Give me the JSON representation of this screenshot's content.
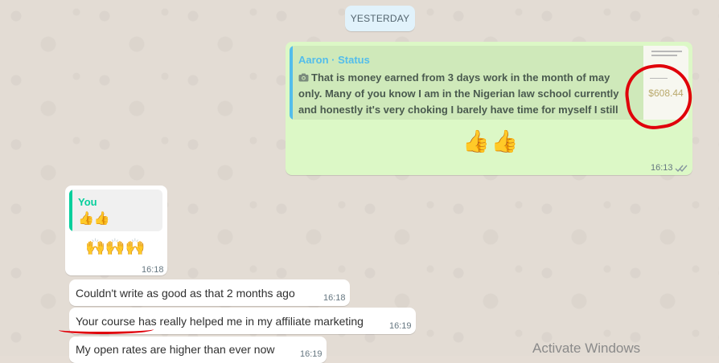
{
  "date_divider": "YESTERDAY",
  "outgoing_reply": {
    "quote_author": "Aaron · Status",
    "quote_text": "That is money earned from  3 days work in the month of may only. Many of you know I am in the Nigerian law school currently and honestly it's very choking I barely have time for myself I still",
    "thumbnail_amount": "$608.44",
    "message": "👍👍",
    "time": "16:13",
    "status_icon": "double-check-read"
  },
  "incoming_reply": {
    "quote_author": "You",
    "quote_text": "👍👍",
    "message": "🙌🙌🙌",
    "time": "16:18"
  },
  "messages": [
    {
      "text": "Couldn't write as good as that 2 months ago",
      "time": "16:18"
    },
    {
      "text": "Your course has really helped me in my affiliate marketing",
      "time": "16:19"
    },
    {
      "text": "My open rates are higher than ever now",
      "time": "16:19"
    }
  ],
  "watermark": "Activate Windows",
  "colors": {
    "outgoing_bubble": "#dcf8c6",
    "incoming_bubble": "#ffffff",
    "status_quote_bar": "#53bdeb",
    "self_quote_bar": "#06cf9c",
    "annotation_red": "#e0000a"
  }
}
